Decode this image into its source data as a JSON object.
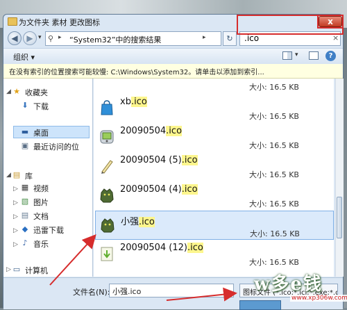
{
  "window": {
    "title": "为文件夹 素材 更改图标",
    "close_label": "x"
  },
  "address": {
    "path": "“System32”中的搜索结果",
    "search_value": ".ico",
    "clear_label": "×"
  },
  "toolbar": {
    "organize_label": "组织 ▾"
  },
  "infobar": {
    "text": "在没有索引的位置搜索可能较慢: C:\\Windows\\System32。请单击以添加到索引..."
  },
  "sidebar": {
    "favorites_label": "收藏夹",
    "favorites": [
      "下载",
      "桌面",
      "最近访问的位"
    ],
    "library_label": "库",
    "libraries": [
      "视频",
      "图片",
      "文档",
      "迅雷下载",
      "音乐"
    ],
    "computer_label": "计算机"
  },
  "files": {
    "ext": ".ico",
    "items": [
      {
        "stem": "",
        "size": "大小: 16.5 KB"
      },
      {
        "stem": "xb",
        "size": "大小: 16.5 KB"
      },
      {
        "stem": "20090504",
        "size": "大小: 16.5 KB"
      },
      {
        "stem": "20090504 (5)",
        "size": "大小: 16.5 KB"
      },
      {
        "stem": "20090504 (4)",
        "size": "大小: 16.5 KB"
      },
      {
        "stem": "小强",
        "size": "大小: 16.5 KB"
      },
      {
        "stem": "20090504 (12)",
        "size": "大小: 16.5 KB"
      }
    ]
  },
  "bottom": {
    "filename_label": "文件名(N):",
    "filename_value": "小强.ico",
    "filetype_value": "图标文件 (*.ico;*.icl;*.exe;*.dll)"
  },
  "watermark": {
    "text": "w多e钱",
    "url": "www.xp306w.com"
  },
  "colors": {
    "annotation_red": "#d62c2c",
    "highlight_yellow": "#fdf68d",
    "selection_blue": "#dbeafb"
  }
}
